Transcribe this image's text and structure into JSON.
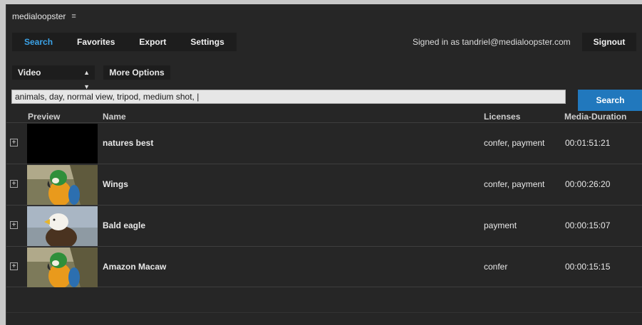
{
  "app": {
    "title": "medialoopster",
    "menu_icon": "hamburger-icon"
  },
  "nav": {
    "tabs": [
      {
        "label": "Search",
        "active": true
      },
      {
        "label": "Favorites",
        "active": false
      },
      {
        "label": "Export",
        "active": false
      },
      {
        "label": "Settings",
        "active": false
      }
    ],
    "signed_in": "Signed in as tandriel@medialoopster.com",
    "signout_label": "Signout"
  },
  "filters": {
    "media_type": "Video",
    "more_options_label": "More Options"
  },
  "search": {
    "query": "animals, day, normal view, tripod, medium shot, |",
    "button_label": "Search"
  },
  "table": {
    "columns": {
      "preview": "Preview",
      "name": "Name",
      "licenses": "Licenses",
      "duration": "Media-Duration"
    },
    "rows": [
      {
        "name": "natures best",
        "licenses": "confer, payment",
        "duration": "00:01:51:21",
        "thumb": "black"
      },
      {
        "name": "Wings",
        "licenses": "confer, payment",
        "duration": "00:00:26:20",
        "thumb": "parrot"
      },
      {
        "name": "Bald eagle",
        "licenses": "payment",
        "duration": "00:00:15:07",
        "thumb": "eagle"
      },
      {
        "name": "Amazon Macaw",
        "licenses": "confer",
        "duration": "00:00:15:15",
        "thumb": "parrot"
      }
    ]
  },
  "colors": {
    "accent": "#3ba3e8",
    "search_button": "#2178bd",
    "panel": "#262626"
  }
}
